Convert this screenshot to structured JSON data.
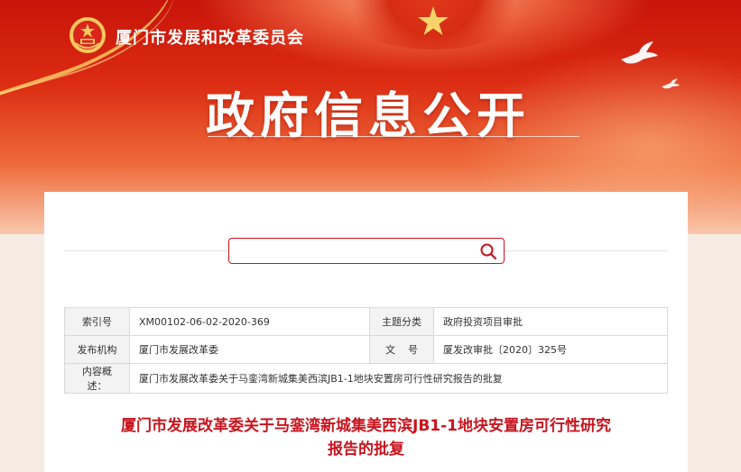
{
  "header": {
    "org_name": "厦门市发展和改革委员会",
    "page_title": "政府信息公开"
  },
  "search": {
    "value": "",
    "placeholder": ""
  },
  "meta_table": {
    "index_label": "索引号",
    "index_value": "XM00102-06-02-2020-369",
    "category_label": "主题分类",
    "category_value": "政府投资项目审批",
    "publisher_label": "发布机构",
    "publisher_value": "厦门市发展改革委",
    "doc_no_label": "文    号",
    "doc_no_value": "厦发改审批〔2020〕325号",
    "summary_label": "内容概述：",
    "summary_value": "厦门市发展改革委关于马銮湾新城集美西滨JB1-1地块安置房可行性研究报告的批复"
  },
  "document": {
    "title_line1": "厦门市发展改革委关于马銮湾新城集美西滨JB1-1地块安置房可行性研究",
    "title_line2": "报告的批复"
  },
  "colors": {
    "brand_red": "#c8141e",
    "banner_red": "#db2b12",
    "gold": "#f6c85f"
  },
  "icons": {
    "logo": "national-emblem-icon",
    "search": "search-icon",
    "decor": "dove-icon"
  }
}
